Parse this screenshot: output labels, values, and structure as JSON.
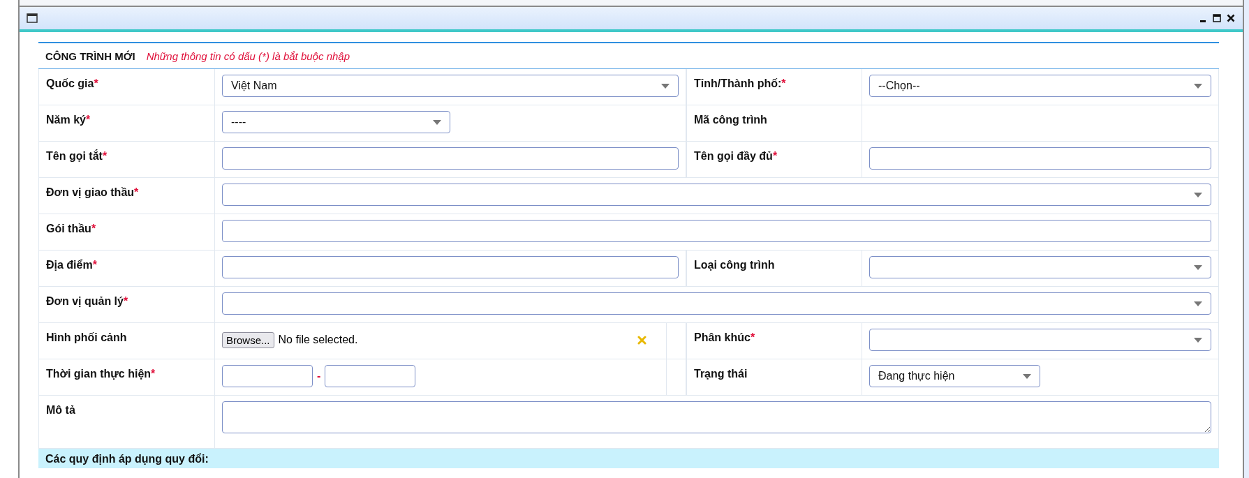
{
  "form": {
    "title": "CÔNG TRÌNH MỚI",
    "note": "Những thông tin có dấu (*) là bắt buộc nhập"
  },
  "rows": [
    {
      "fields": [
        {
          "label": "Quốc gia",
          "asterisk": "*",
          "control": {
            "kind": "select",
            "value": "Việt Nam"
          }
        },
        {
          "label": "Tỉnh/Thành phố:",
          "asterisk": "*",
          "control": {
            "kind": "select",
            "value": "--Chọn--"
          }
        }
      ]
    },
    {
      "fields": [
        {
          "label": "Năm ký",
          "asterisk": "*",
          "control": {
            "kind": "short-select",
            "value": "----"
          }
        },
        {
          "label": "Mã công trình",
          "control": {
            "kind": "none"
          }
        }
      ]
    },
    {
      "fields": [
        {
          "label": "Tên gọi tắt",
          "asterisk": "*",
          "control": {
            "kind": "text"
          }
        },
        {
          "label": "Tên gọi đầy đủ",
          "asterisk": "*",
          "control": {
            "kind": "text"
          }
        }
      ]
    },
    {
      "fields": [
        {
          "label": "Đơn vị giao thầu",
          "asterisk": "*",
          "control": {
            "kind": "select"
          }
        }
      ]
    },
    {
      "fields": [
        {
          "label": "Gói thầu",
          "asterisk": "*",
          "control": {
            "kind": "text"
          }
        }
      ]
    },
    {
      "fields": [
        {
          "label": "Địa điểm",
          "asterisk": "*",
          "control": {
            "kind": "text"
          }
        },
        {
          "label": "Loại công trình",
          "control": {
            "kind": "select"
          }
        }
      ]
    },
    {
      "fields": [
        {
          "label": "Đơn vị quản lý",
          "asterisk": "*",
          "control": {
            "kind": "select"
          }
        }
      ]
    },
    {
      "fields": [
        {
          "label": "Hình phối cảnh",
          "control": {
            "kind": "file",
            "button": "Browse...",
            "status": "No file selected."
          }
        },
        {
          "label": "Phân khúc",
          "asterisk": "*",
          "control": {
            "kind": "select"
          }
        }
      ]
    },
    {
      "fields": [
        {
          "label": "Thời gian thực hiện",
          "asterisk": "*",
          "control": {
            "kind": "range",
            "separator": "-"
          }
        },
        {
          "label": "Trạng thái",
          "control": {
            "kind": "short-select",
            "value": "Đang thực hiện"
          }
        }
      ]
    },
    {
      "fields": [
        {
          "label": "Mô tả",
          "control": {
            "kind": "textarea"
          }
        }
      ]
    }
  ],
  "section": {
    "title": "Các quy định áp dụng quy đổi:"
  }
}
